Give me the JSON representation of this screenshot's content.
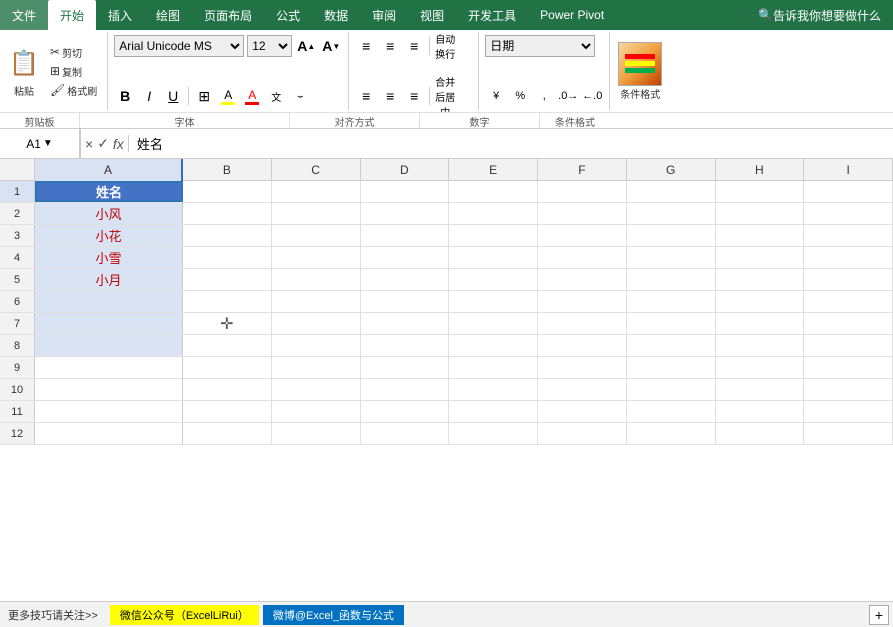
{
  "ribbon": {
    "tabs": [
      {
        "id": "file",
        "label": "文件"
      },
      {
        "id": "home",
        "label": "开始",
        "active": true
      },
      {
        "id": "insert",
        "label": "插入"
      },
      {
        "id": "draw",
        "label": "绘图"
      },
      {
        "id": "page-layout",
        "label": "页面布局"
      },
      {
        "id": "formula",
        "label": "公式"
      },
      {
        "id": "data",
        "label": "数据"
      },
      {
        "id": "review",
        "label": "审阅"
      },
      {
        "id": "view",
        "label": "视图"
      },
      {
        "id": "developer",
        "label": "开发工具"
      },
      {
        "id": "power-pivot",
        "label": "Power Pivot"
      }
    ],
    "search_placeholder": "告诉我你想要做什么"
  },
  "toolbar": {
    "sections": {
      "clipboard": {
        "label": "剪贴板",
        "paste": "粘贴",
        "cut": "剪切",
        "copy": "复制",
        "format_painter": "格式刷"
      },
      "font": {
        "label": "字体",
        "font_name": "Arial Unicode MS",
        "font_size": "12",
        "bold": "B",
        "italic": "I",
        "underline": "U",
        "border": "⊞",
        "fill_color": "A",
        "font_color": "A",
        "increase_font": "A",
        "decrease_font": "A"
      },
      "alignment": {
        "label": "对齐方式",
        "wrap_text": "自动换行",
        "merge_center": "合并后居中"
      },
      "number": {
        "label": "数字",
        "format": "日期"
      },
      "conditional": {
        "label": "条件格式"
      }
    }
  },
  "formula_bar": {
    "cell_ref": "A1",
    "formula_value": "姓名",
    "cancel_label": "×",
    "confirm_label": "✓",
    "function_label": "fx"
  },
  "spreadsheet": {
    "columns": [
      "A",
      "B",
      "C",
      "D",
      "E",
      "F",
      "G",
      "H",
      "I"
    ],
    "rows": [
      {
        "num": "1",
        "cells": [
          "姓名",
          "",
          "",
          "",
          "",
          "",
          "",
          "",
          ""
        ],
        "selected": true
      },
      {
        "num": "2",
        "cells": [
          "小风",
          "",
          "",
          "",
          "",
          "",
          "",
          "",
          ""
        ]
      },
      {
        "num": "3",
        "cells": [
          "小花",
          "",
          "",
          "",
          "",
          "",
          "",
          "",
          ""
        ]
      },
      {
        "num": "4",
        "cells": [
          "小雪",
          "",
          "",
          "",
          "",
          "",
          "",
          "",
          ""
        ]
      },
      {
        "num": "5",
        "cells": [
          "小月",
          "",
          "",
          "",
          "",
          "",
          "",
          "",
          ""
        ]
      },
      {
        "num": "6",
        "cells": [
          "",
          "",
          "",
          "",
          "",
          "",
          "",
          "",
          ""
        ]
      },
      {
        "num": "7",
        "cells": [
          "",
          "",
          "",
          "",
          "",
          "",
          "",
          "",
          ""
        ]
      },
      {
        "num": "8",
        "cells": [
          "",
          "",
          "",
          "",
          "",
          "",
          "",
          "",
          ""
        ]
      },
      {
        "num": "9",
        "cells": [
          "",
          "",
          "",
          "",
          "",
          "",
          "",
          "",
          ""
        ]
      },
      {
        "num": "10",
        "cells": [
          "",
          "",
          "",
          "",
          "",
          "",
          "",
          "",
          ""
        ]
      },
      {
        "num": "11",
        "cells": [
          "",
          "",
          "",
          "",
          "",
          "",
          "",
          "",
          ""
        ]
      },
      {
        "num": "12",
        "cells": [
          "",
          "",
          "",
          "",
          "",
          "",
          "",
          "",
          ""
        ]
      }
    ]
  },
  "status_bar": {
    "hint": "更多技巧请关注>>",
    "badge1": "微信公众号（ExcelLiRui）",
    "badge2": "微博@Excel_函数与公式"
  }
}
